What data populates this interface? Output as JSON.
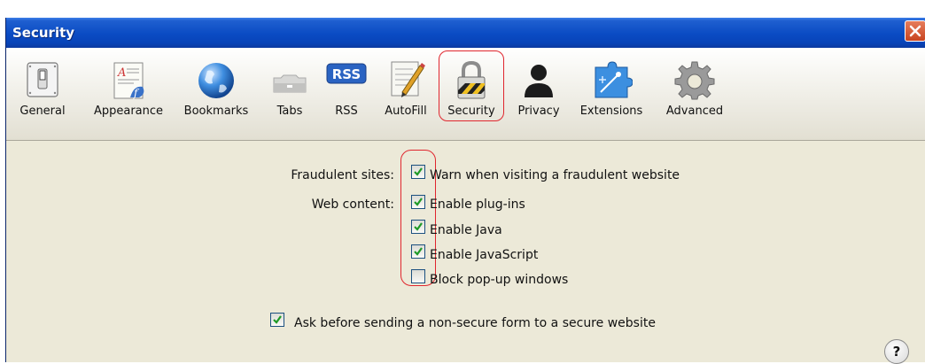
{
  "window": {
    "title": "Security"
  },
  "toolbar": {
    "items": [
      {
        "label": "General",
        "icon": "general-switch-icon"
      },
      {
        "label": "Appearance",
        "icon": "appearance-icon"
      },
      {
        "label": "Bookmarks",
        "icon": "globe-icon"
      },
      {
        "label": "Tabs",
        "icon": "tabs-icon"
      },
      {
        "label": "RSS",
        "icon": "rss-icon",
        "icon_text": "RSS"
      },
      {
        "label": "AutoFill",
        "icon": "autofill-pencil-icon"
      },
      {
        "label": "Security",
        "icon": "padlock-icon",
        "selected": true
      },
      {
        "label": "Privacy",
        "icon": "person-silhouette-icon"
      },
      {
        "label": "Extensions",
        "icon": "extensions-puzzle-icon"
      },
      {
        "label": "Advanced",
        "icon": "gear-icon"
      }
    ]
  },
  "security": {
    "fraudulent_label": "Fraudulent sites:",
    "fraudulent_option": {
      "label": "Warn when visiting a fraudulent website",
      "checked": true
    },
    "web_content_label": "Web content:",
    "web_content_options": [
      {
        "label": "Enable plug-ins",
        "checked": true
      },
      {
        "label": "Enable Java",
        "checked": true
      },
      {
        "label": "Enable JavaScript",
        "checked": true
      },
      {
        "label": "Block pop-up windows",
        "checked": false
      }
    ],
    "ask_option": {
      "label": "Ask before sending a non-secure form to a secure website",
      "checked": true
    }
  },
  "help": {
    "label": "?"
  },
  "colors": {
    "title_bar": "#0a4bc3",
    "highlight_ring": "#e0262e",
    "check": "#1f9a27"
  }
}
